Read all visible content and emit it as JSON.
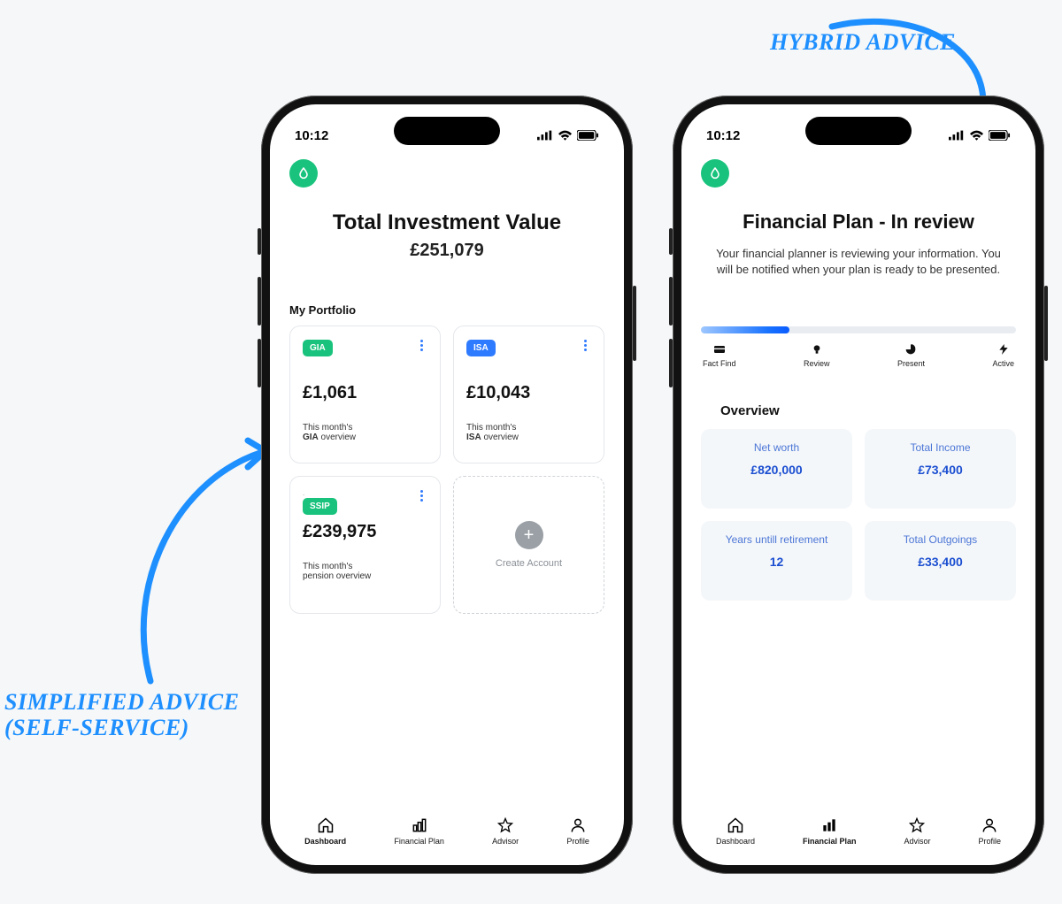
{
  "annotations": {
    "left_line1": "Simplified Advice",
    "left_line2": "(Self-Service)",
    "right": "Hybrid Advice"
  },
  "status": {
    "time": "10:12"
  },
  "left_phone": {
    "title": "Total Investment Value",
    "total": "£251,079",
    "section": "My Portfolio",
    "cards": [
      {
        "badge": "GIA",
        "badge_color": "green",
        "value": "£1,061",
        "sub1": "This month's",
        "sub2_bold": "GIA",
        "sub2_rest": " overview"
      },
      {
        "badge": "ISA",
        "badge_color": "blue",
        "value": "£10,043",
        "sub1": "This month's",
        "sub2_bold": "ISA",
        "sub2_rest": " overview"
      },
      {
        "badge": "SSIP",
        "badge_color": "green",
        "value": "£239,975",
        "sub1": "This month's",
        "sub2_bold": "pension",
        "sub2_rest": " overview"
      }
    ],
    "create_label": "Create Account"
  },
  "right_phone": {
    "title": "Financial Plan - In review",
    "desc": "Your financial planner is reviewing your information. You will be notified when your plan is ready to be presented.",
    "steps": [
      "Fact Find",
      "Review",
      "Present",
      "Active"
    ],
    "overview_title": "Overview",
    "overview": [
      {
        "label": "Net worth",
        "value": "£820,000"
      },
      {
        "label": "Total Income",
        "value": "£73,400"
      },
      {
        "label": "Years untill retirement",
        "value": "12"
      },
      {
        "label": "Total Outgoings",
        "value": "£33,400"
      }
    ]
  },
  "nav": {
    "items": [
      "Dashboard",
      "Financial Plan",
      "Advisor",
      "Profile"
    ]
  }
}
